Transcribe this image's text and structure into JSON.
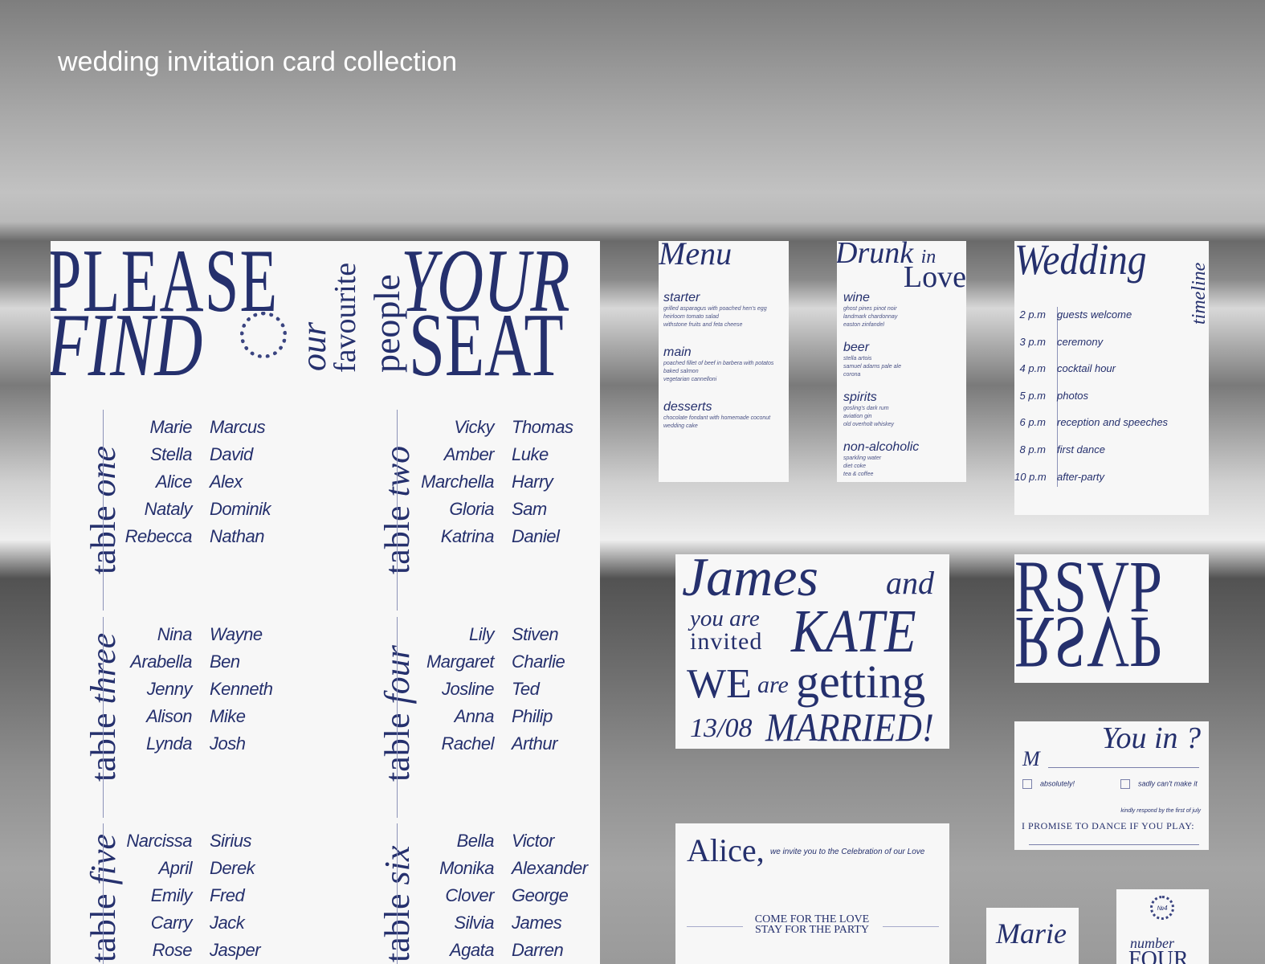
{
  "page_title": "wedding invitation card collection",
  "colors": {
    "navy": "#25306d"
  },
  "seating": {
    "header": {
      "please": "PLEASE",
      "find": "FIND",
      "our": "our",
      "favourite": "favourite",
      "people": "people",
      "your": "YOUR",
      "seat": "SEAT",
      "seal": "KJRKJRKJRKJRKJRKJRKJRKJR"
    },
    "tables": [
      {
        "label": "table",
        "num": "one",
        "guests": [
          [
            "Marie",
            "Marcus"
          ],
          [
            "Stella",
            "David"
          ],
          [
            "Alice",
            "Alex"
          ],
          [
            "Nataly",
            "Dominik"
          ],
          [
            "Rebecca",
            "Nathan"
          ]
        ]
      },
      {
        "label": "table",
        "num": "two",
        "guests": [
          [
            "Vicky",
            "Thomas"
          ],
          [
            "Amber",
            "Luke"
          ],
          [
            "Marchella",
            "Harry"
          ],
          [
            "Gloria",
            "Sam"
          ],
          [
            "Katrina",
            "Daniel"
          ]
        ]
      },
      {
        "label": "table",
        "num": "three",
        "guests": [
          [
            "Nina",
            "Wayne"
          ],
          [
            "Arabella",
            "Ben"
          ],
          [
            "Jenny",
            "Kenneth"
          ],
          [
            "Alison",
            "Mike"
          ],
          [
            "Lynda",
            "Josh"
          ]
        ]
      },
      {
        "label": "table",
        "num": "four",
        "guests": [
          [
            "Lily",
            "Stiven"
          ],
          [
            "Margaret",
            "Charlie"
          ],
          [
            "Josline",
            "Ted"
          ],
          [
            "Anna",
            "Philip"
          ],
          [
            "Rachel",
            "Arthur"
          ]
        ]
      },
      {
        "label": "table",
        "num": "five",
        "guests": [
          [
            "Narcissa",
            "Sirius"
          ],
          [
            "April",
            "Derek"
          ],
          [
            "Emily",
            "Fred"
          ],
          [
            "Carry",
            "Jack"
          ],
          [
            "Rose",
            "Jasper"
          ]
        ]
      },
      {
        "label": "table",
        "num": "six",
        "guests": [
          [
            "Bella",
            "Victor"
          ],
          [
            "Monika",
            "Alexander"
          ],
          [
            "Clover",
            "George"
          ],
          [
            "Silvia",
            "James"
          ],
          [
            "Agata",
            "Darren"
          ]
        ]
      }
    ]
  },
  "menu": {
    "title": "Menu",
    "sections": [
      {
        "name": "starter",
        "items": [
          "grilled asparagus with poached hen's egg",
          "heirloom tomato salad",
          "withstone fruits and feta cheese"
        ]
      },
      {
        "name": "main",
        "items": [
          "poached fillet of beef in barbera with potatos",
          "baked salmon",
          "vegetarian cannelloni"
        ]
      },
      {
        "name": "desserts",
        "items": [
          "chocolate fondant with homemade coconut",
          "wedding cake"
        ]
      }
    ]
  },
  "drinks": {
    "title1": "Drunk",
    "title_in": "in",
    "title2": "Love",
    "sections": [
      {
        "name": "wine",
        "items": [
          "ghost pines pinot noir",
          "landmark chardonnay",
          "easton zinfandel"
        ]
      },
      {
        "name": "beer",
        "items": [
          "stella artois",
          "samuel adams pale ale",
          "corona"
        ]
      },
      {
        "name": "spirits",
        "items": [
          "gosling's dark rum",
          "aviation gin",
          "old overholt whiskey"
        ]
      },
      {
        "name": "non-alcoholic",
        "items": [
          "sparkling water",
          "diet coke",
          "tea & coffee"
        ]
      }
    ]
  },
  "timeline": {
    "title": "Wedding",
    "side": "timeline",
    "rows": [
      {
        "time": "2 p.m",
        "event": "guests welcome"
      },
      {
        "time": "3 p.m",
        "event": "ceremony"
      },
      {
        "time": "4 p.m",
        "event": "cocktail hour"
      },
      {
        "time": "5 p.m",
        "event": "photos"
      },
      {
        "time": "6 p.m",
        "event": "reception and speeches"
      },
      {
        "time": "8 p.m",
        "event": "first dance"
      },
      {
        "time": "10 p.m",
        "event": "after-party"
      }
    ]
  },
  "invite": {
    "james": "James",
    "and": "and",
    "you_are": "you are",
    "invited": "invited",
    "kate": "KATE",
    "we": "WE",
    "are": "are",
    "getting": "getting",
    "date": "13/08",
    "married": "MARRIED!"
  },
  "rsvp": {
    "title": "RSVP"
  },
  "reply": {
    "title": "You in ?",
    "m": "M",
    "yes": "absolutely!",
    "no": "sadly can't make it",
    "respond": "kindly respond by the first of july",
    "promise": "I PROMISE TO DANCE IF YOU PLAY:"
  },
  "alice": {
    "name": "Alice,",
    "line": "we invite you to the Celebration of our Love",
    "tag1": "COME FOR THE LOVE",
    "tag2": "STAY FOR THE PARTY"
  },
  "place": {
    "name": "Marie"
  },
  "number": {
    "seal": "№4",
    "label": "number",
    "value": "FOUR"
  }
}
